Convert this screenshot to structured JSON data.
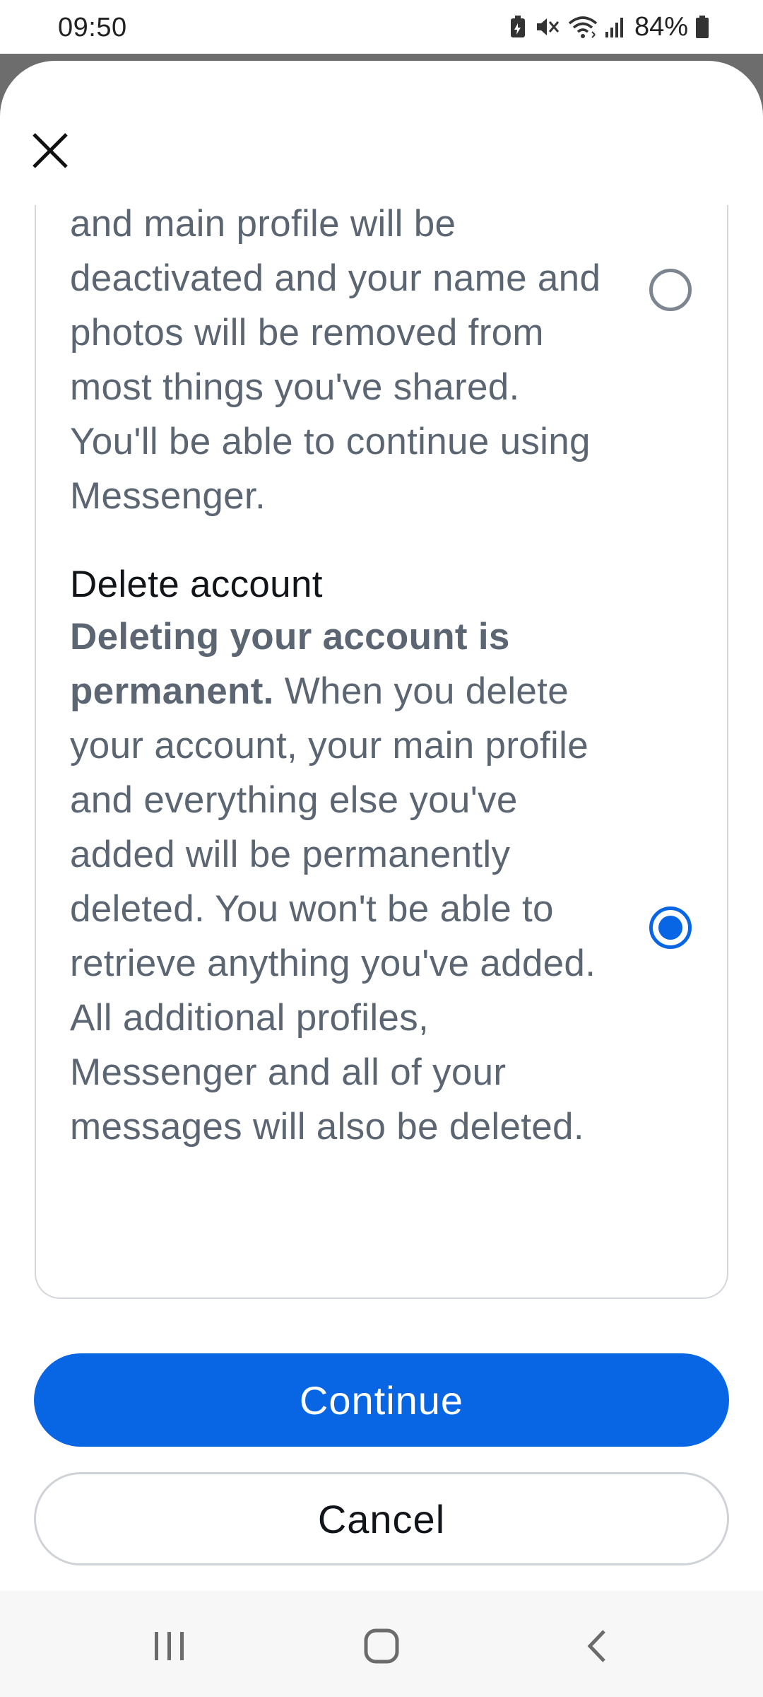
{
  "status_bar": {
    "time": "09:50",
    "battery": "84%",
    "icons": [
      "battery-saver-icon",
      "mute-icon",
      "wifi-icon",
      "signal-icon",
      "battery-icon"
    ]
  },
  "sheet": {
    "close_icon": "close-icon",
    "options": [
      {
        "text": "and main profile will be deactivated and your name and photos will be removed from most things you've shared. You'll be able to continue using Messenger.",
        "selected": false
      },
      {
        "title": "Delete account",
        "bold_text": "Deleting your account is permanent.",
        "text": " When you delete your account, your main profile and everything else you've added will be permanently deleted. You won't be able to retrieve anything you've added. All additional profiles, Messenger and all of your messages will also be deleted.",
        "selected": true
      }
    ],
    "continue_label": "Continue",
    "cancel_label": "Cancel"
  },
  "colors": {
    "primary": "#0866e4",
    "secondary_text": "#5b6672",
    "primary_text": "#111418",
    "border": "#d3d6db"
  },
  "nav_bar": {
    "icons": [
      "recent-apps-icon",
      "home-icon",
      "back-icon"
    ]
  }
}
